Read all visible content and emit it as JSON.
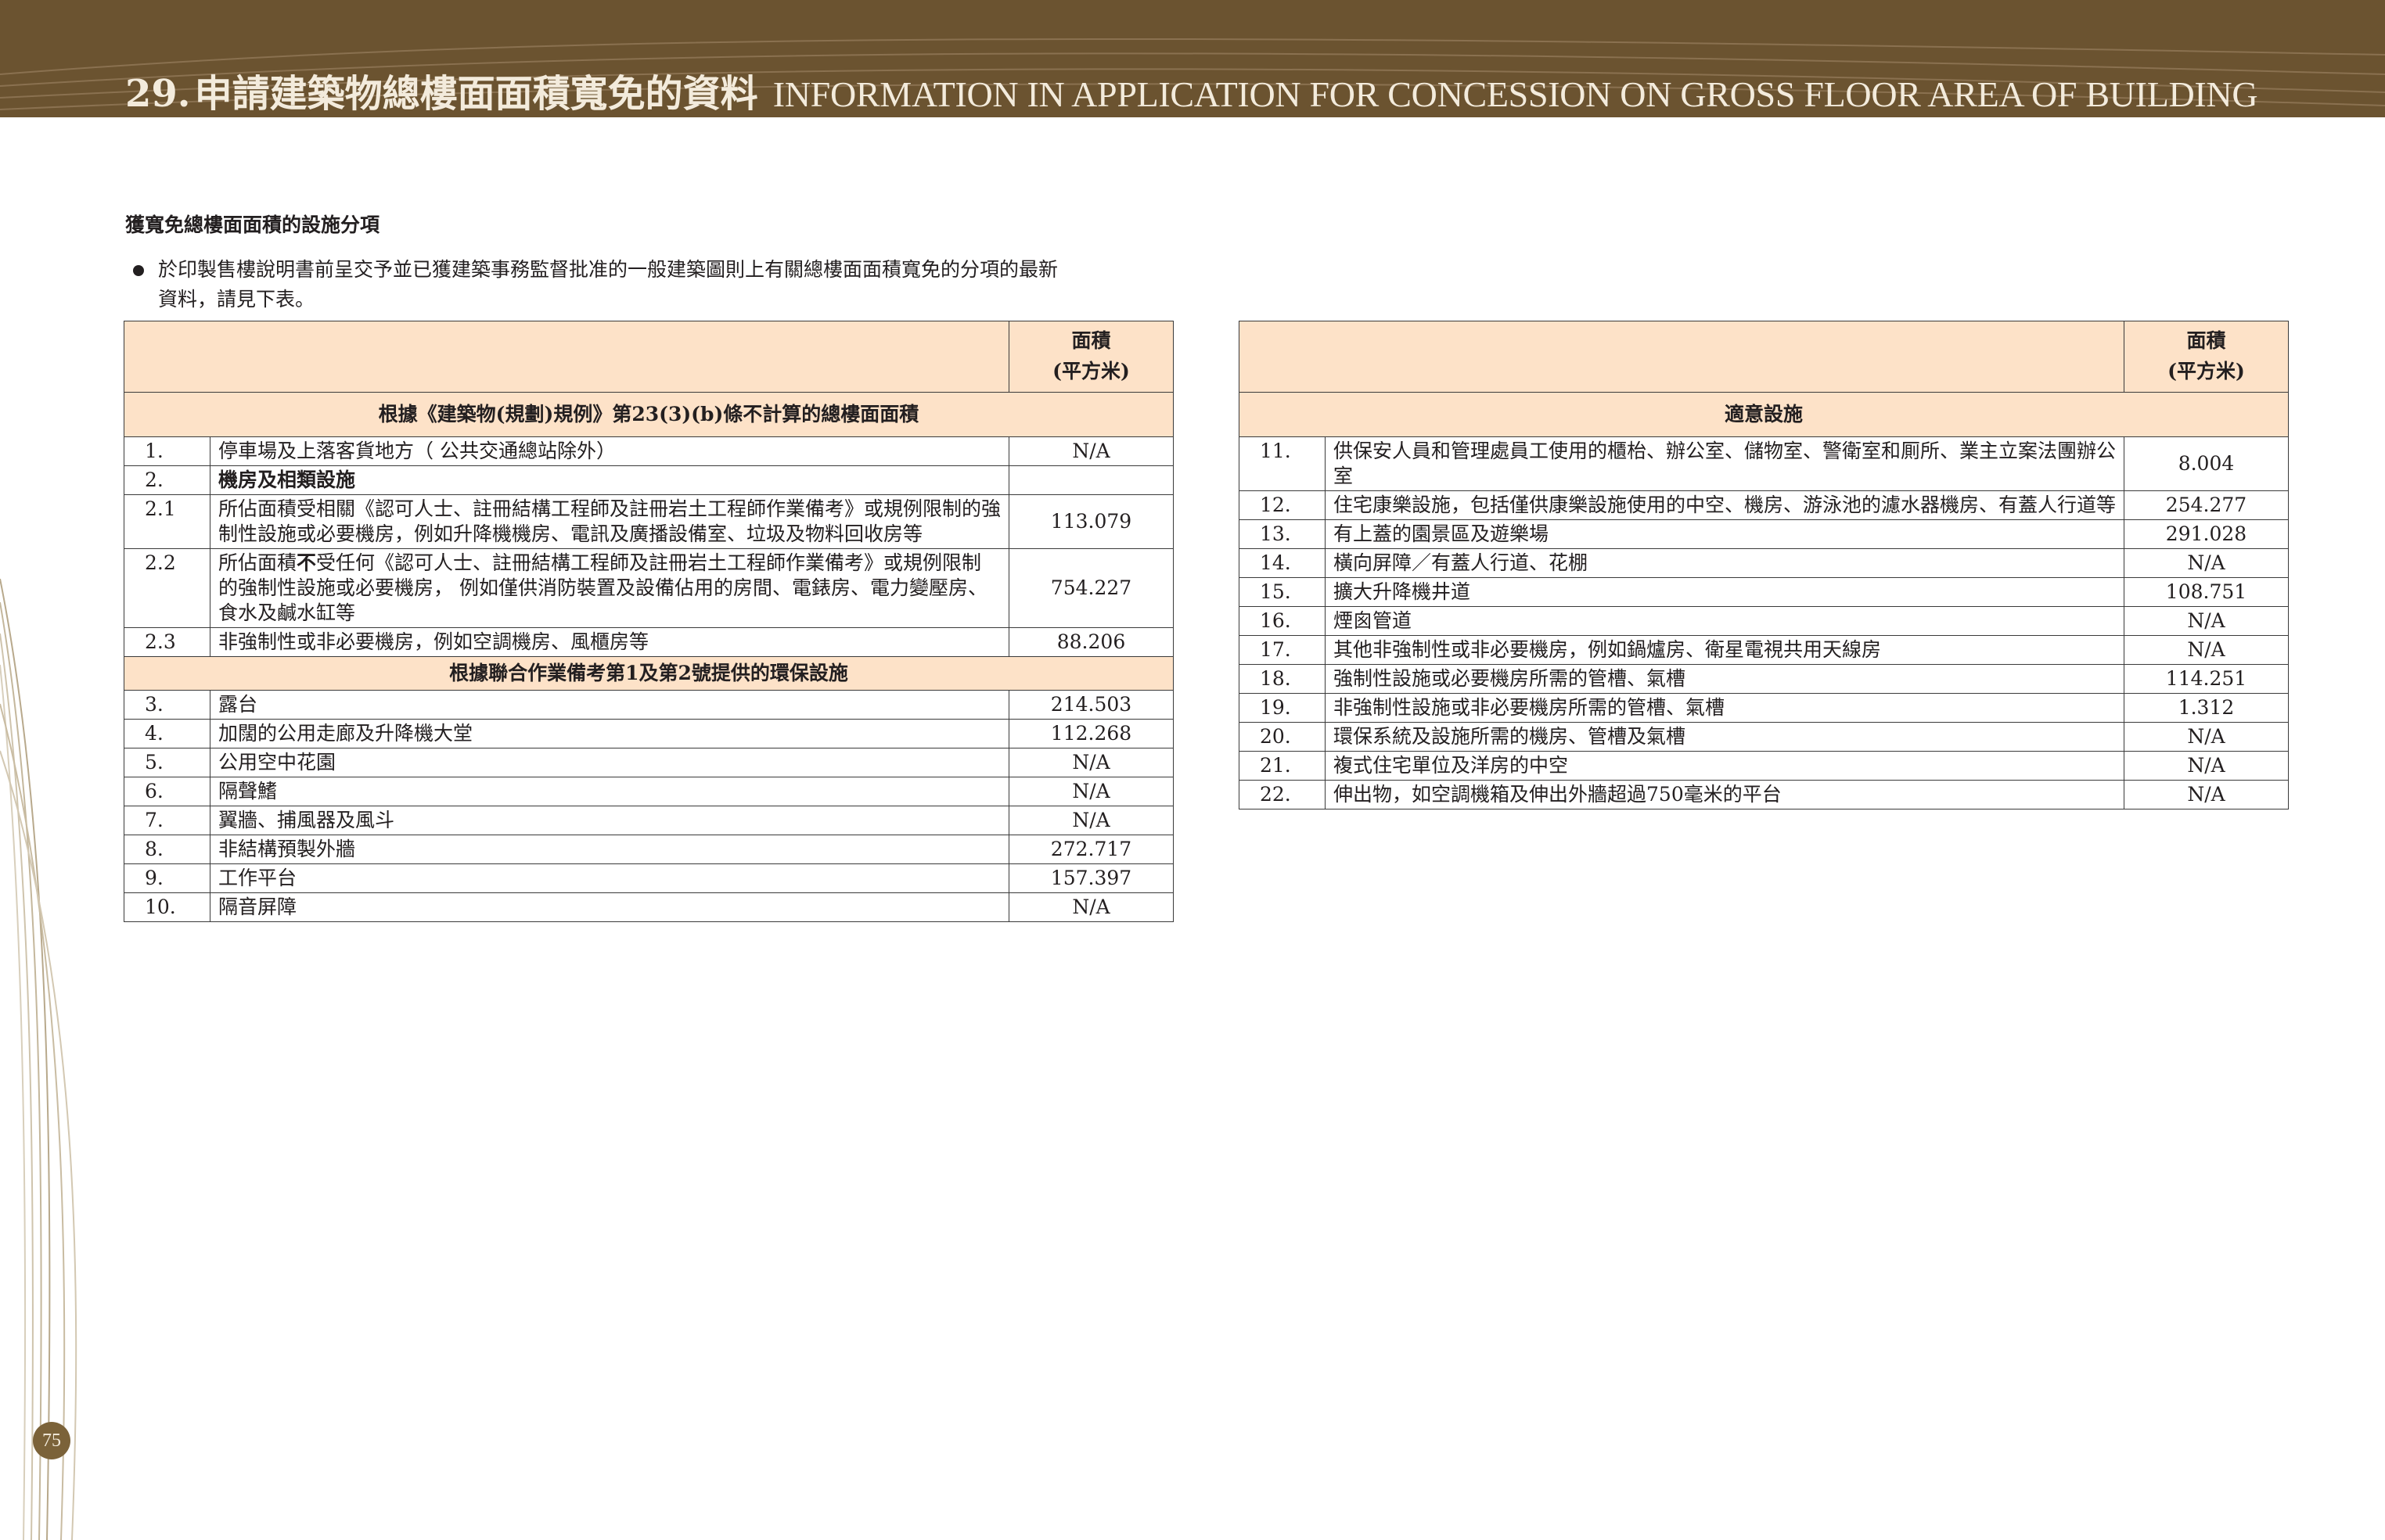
{
  "header": {
    "number": "29.",
    "title_zh": "申請建築物總樓面面積寬免的資料",
    "title_en": "INFORMATION IN APPLICATION FOR CONCESSION ON GROSS FLOOR AREA OF BUILDING"
  },
  "intro": {
    "heading": "獲寬免總樓面面積的設施分項",
    "bullet_line1": "於印製售樓說明書前呈交予並已獲建築事務監督批准的一般建築圖則上有關總樓面面積寬免的分項的最新",
    "bullet_line2": "資料，請見下表。"
  },
  "left_table": {
    "area_header_line1": "面積",
    "area_header_line2": "(平方米)",
    "section1_title": "根據《建築物(規劃)規例》第23(3)(b)條不計算的總樓面面積",
    "section2_title": "根據聯合作業備考第1及第2號提供的環保設施",
    "rows1": [
      {
        "no": "1.",
        "desc": "停車場及上落客貨地方（ 公共交通總站除外）",
        "area": "N/A"
      },
      {
        "no": "2.",
        "desc": "機房及相類設施",
        "area": ""
      },
      {
        "no": "2.1",
        "desc": "所佔面積受相關《認可人士、註冊結構工程師及註冊岩土工程師作業備考》或規例限制的強制性設施或必要機房，例如升降機機房、電訊及廣播設備室、垃圾及物料回收房等",
        "area": "113.079"
      },
      {
        "no": "2.2",
        "desc_pre": "所佔面積",
        "desc_bold": "不",
        "desc_post": "受任何《認可人士、註冊結構工程師及註冊岩土工程師作業備考》或規例限制的強制性設施或必要機房， 例如僅供消防裝置及設備佔用的房間、電錶房、電力變壓房、食水及鹹水缸等",
        "area": "754.227"
      },
      {
        "no": "2.3",
        "desc": "非強制性或非必要機房，例如空調機房、風櫃房等",
        "area": "88.206"
      }
    ],
    "rows2": [
      {
        "no": "3.",
        "desc": "露台",
        "area": "214.503"
      },
      {
        "no": "4.",
        "desc": "加闊的公用走廊及升降機大堂",
        "area": "112.268"
      },
      {
        "no": "5.",
        "desc": "公用空中花園",
        "area": "N/A"
      },
      {
        "no": "6.",
        "desc": "隔聲鰭",
        "area": "N/A"
      },
      {
        "no": "7.",
        "desc": "翼牆、捕風器及風斗",
        "area": "N/A"
      },
      {
        "no": "8.",
        "desc": "非結構預製外牆",
        "area": "272.717"
      },
      {
        "no": "9.",
        "desc": "工作平台",
        "area": "157.397"
      },
      {
        "no": "10.",
        "desc": "隔音屏障",
        "area": "N/A"
      }
    ]
  },
  "right_table": {
    "area_header_line1": "面積",
    "area_header_line2": "(平方米)",
    "section_title": "適意設施",
    "rows": [
      {
        "no": "11.",
        "desc": "供保安人員和管理處員工使用的櫃枱、辦公室、儲物室、警衛室和厠所、業主立案法團辦公室",
        "area": "8.004"
      },
      {
        "no": "12.",
        "desc": "住宅康樂設施，包括僅供康樂設施使用的中空、機房、游泳池的濾水器機房、有蓋人行道等",
        "area": "254.277"
      },
      {
        "no": "13.",
        "desc": "有上蓋的園景區及遊樂場",
        "area": "291.028"
      },
      {
        "no": "14.",
        "desc": "橫向屏障／有蓋人行道、花棚",
        "area": "N/A"
      },
      {
        "no": "15.",
        "desc": "擴大升降機井道",
        "area": "108.751"
      },
      {
        "no": "16.",
        "desc": "煙囪管道",
        "area": "N/A"
      },
      {
        "no": "17.",
        "desc": "其他非強制性或非必要機房，例如鍋爐房、衛星電視共用天線房",
        "area": "N/A"
      },
      {
        "no": "18.",
        "desc": "強制性設施或必要機房所需的管槽、氣槽",
        "area": "114.251"
      },
      {
        "no": "19.",
        "desc": "非強制性設施或非必要機房所需的管槽、氣槽",
        "area": "1.312"
      },
      {
        "no": "20.",
        "desc": "環保系統及設施所需的機房、管槽及氣槽",
        "area": "N/A"
      },
      {
        "no": "21.",
        "desc": "複式住宅單位及洋房的中空",
        "area": "N/A"
      },
      {
        "no": "22.",
        "desc": "伸出物，如空調機箱及伸出外牆超過750毫米的平台",
        "area": "N/A"
      }
    ]
  },
  "page_number": "75",
  "colors": {
    "banner": "#6b5330",
    "banner_text": "#f3ebdc",
    "table_header_fill": "#fde2c8",
    "page_number_disc": "#7b6239"
  }
}
